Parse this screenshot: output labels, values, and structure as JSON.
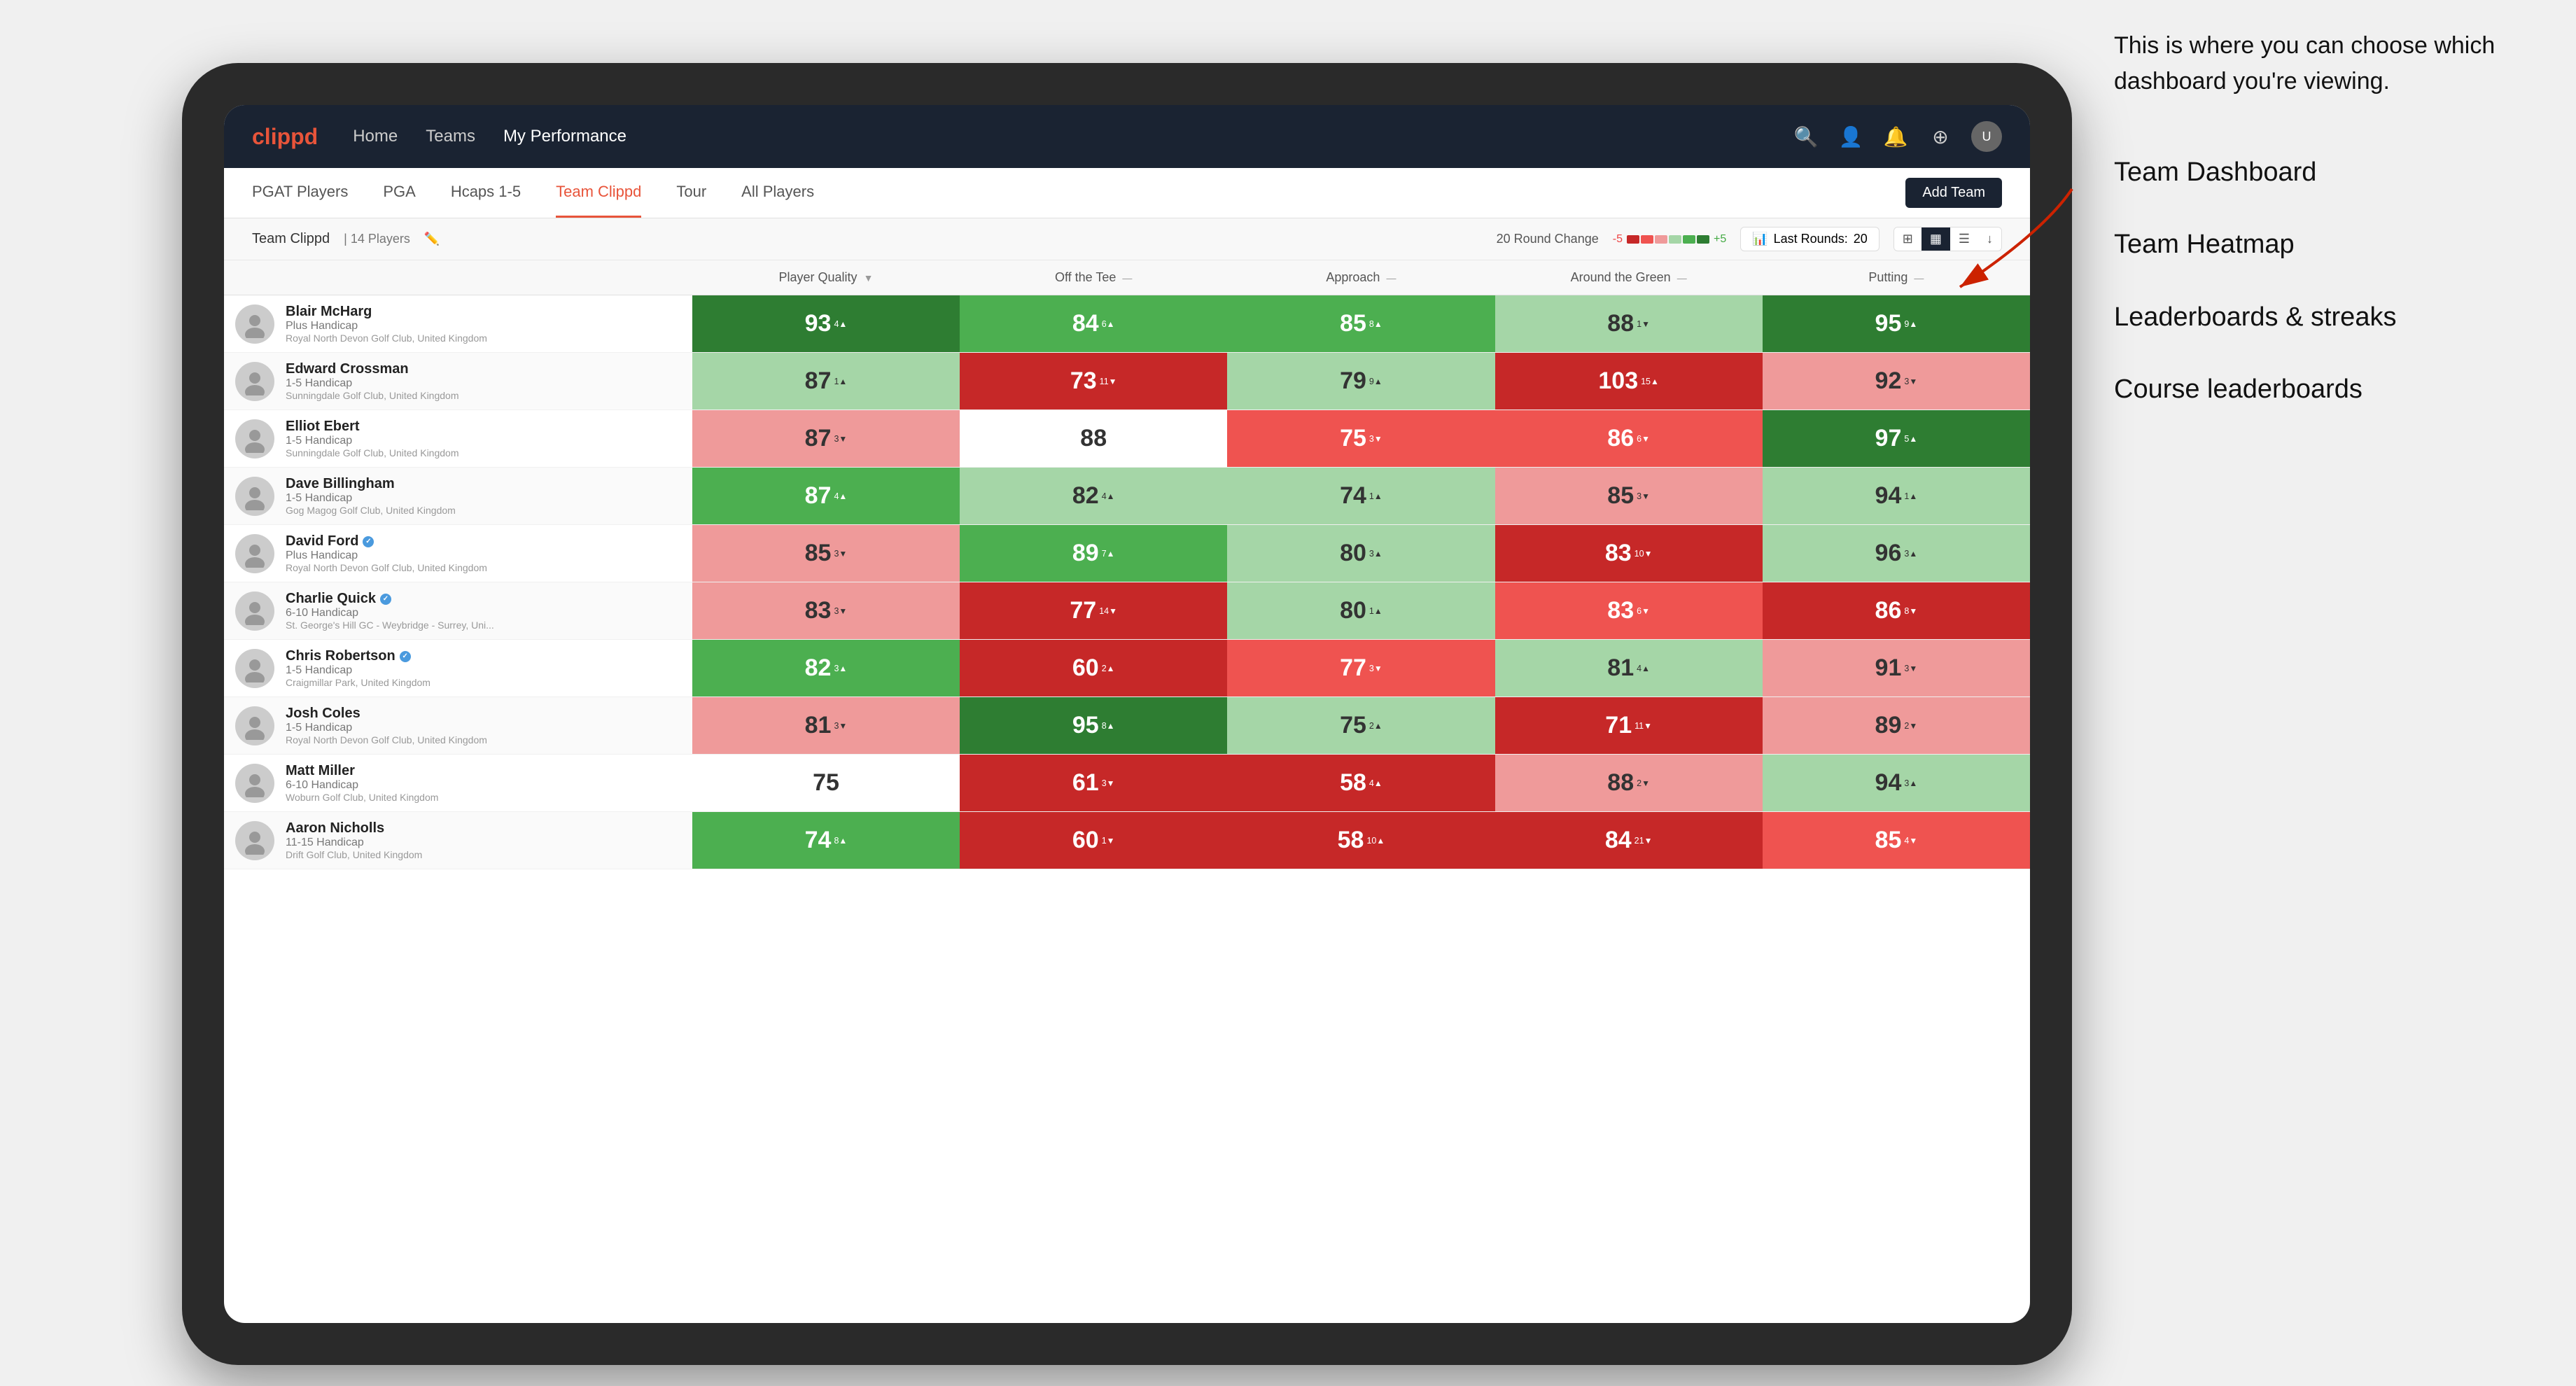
{
  "annotation": {
    "callout": "This is where you can choose which dashboard you're viewing.",
    "menu_items": [
      "Team Dashboard",
      "Team Heatmap",
      "Leaderboards & streaks",
      "Course leaderboards"
    ]
  },
  "nav": {
    "logo": "clippd",
    "links": [
      {
        "label": "Home",
        "active": false
      },
      {
        "label": "Teams",
        "active": false
      },
      {
        "label": "My Performance",
        "active": true
      }
    ],
    "icons": [
      "🔍",
      "👤",
      "🔔",
      "⊕"
    ]
  },
  "sub_nav": {
    "links": [
      {
        "label": "PGAT Players",
        "active": false
      },
      {
        "label": "PGA",
        "active": false
      },
      {
        "label": "Hcaps 1-5",
        "active": false
      },
      {
        "label": "Team Clippd",
        "active": true
      },
      {
        "label": "Tour",
        "active": false
      },
      {
        "label": "All Players",
        "active": false
      }
    ],
    "add_team_label": "Add Team"
  },
  "team_header": {
    "team_name": "Team Clippd",
    "separator": "|",
    "player_count": "14 Players",
    "round_change_label": "20 Round Change",
    "neg_value": "-5",
    "pos_value": "+5",
    "last_rounds_label": "Last Rounds:",
    "last_rounds_value": "20"
  },
  "table": {
    "columns": [
      {
        "label": "Player Quality",
        "sortable": true
      },
      {
        "label": "Off the Tee",
        "sortable": true
      },
      {
        "label": "Approach",
        "sortable": true
      },
      {
        "label": "Around the Green",
        "sortable": true
      },
      {
        "label": "Putting",
        "sortable": true
      }
    ],
    "rows": [
      {
        "name": "Blair McHarg",
        "handicap": "Plus Handicap",
        "club": "Royal North Devon Golf Club, United Kingdom",
        "verified": false,
        "scores": [
          {
            "val": "93",
            "change": "4",
            "dir": "up",
            "color": "green-dark"
          },
          {
            "val": "84",
            "change": "6",
            "dir": "up",
            "color": "green-med"
          },
          {
            "val": "85",
            "change": "8",
            "dir": "up",
            "color": "green-med"
          },
          {
            "val": "88",
            "change": "1",
            "dir": "down",
            "color": "green-light"
          },
          {
            "val": "95",
            "change": "9",
            "dir": "up",
            "color": "green-dark"
          }
        ]
      },
      {
        "name": "Edward Crossman",
        "handicap": "1-5 Handicap",
        "club": "Sunningdale Golf Club, United Kingdom",
        "verified": false,
        "scores": [
          {
            "val": "87",
            "change": "1",
            "dir": "up",
            "color": "green-light"
          },
          {
            "val": "73",
            "change": "11",
            "dir": "down",
            "color": "red-dark"
          },
          {
            "val": "79",
            "change": "9",
            "dir": "up",
            "color": "green-light"
          },
          {
            "val": "103",
            "change": "15",
            "dir": "up",
            "color": "red-dark"
          },
          {
            "val": "92",
            "change": "3",
            "dir": "down",
            "color": "red-light"
          }
        ]
      },
      {
        "name": "Elliot Ebert",
        "handicap": "1-5 Handicap",
        "club": "Sunningdale Golf Club, United Kingdom",
        "verified": false,
        "scores": [
          {
            "val": "87",
            "change": "3",
            "dir": "down",
            "color": "red-light"
          },
          {
            "val": "88",
            "change": "",
            "dir": "",
            "color": "white"
          },
          {
            "val": "75",
            "change": "3",
            "dir": "down",
            "color": "red-med"
          },
          {
            "val": "86",
            "change": "6",
            "dir": "down",
            "color": "red-med"
          },
          {
            "val": "97",
            "change": "5",
            "dir": "up",
            "color": "green-dark"
          }
        ]
      },
      {
        "name": "Dave Billingham",
        "handicap": "1-5 Handicap",
        "club": "Gog Magog Golf Club, United Kingdom",
        "verified": false,
        "scores": [
          {
            "val": "87",
            "change": "4",
            "dir": "up",
            "color": "green-med"
          },
          {
            "val": "82",
            "change": "4",
            "dir": "up",
            "color": "green-light"
          },
          {
            "val": "74",
            "change": "1",
            "dir": "up",
            "color": "green-light"
          },
          {
            "val": "85",
            "change": "3",
            "dir": "down",
            "color": "red-light"
          },
          {
            "val": "94",
            "change": "1",
            "dir": "up",
            "color": "green-light"
          }
        ]
      },
      {
        "name": "David Ford",
        "handicap": "Plus Handicap",
        "club": "Royal North Devon Golf Club, United Kingdom",
        "verified": true,
        "scores": [
          {
            "val": "85",
            "change": "3",
            "dir": "down",
            "color": "red-light"
          },
          {
            "val": "89",
            "change": "7",
            "dir": "up",
            "color": "green-med"
          },
          {
            "val": "80",
            "change": "3",
            "dir": "up",
            "color": "green-light"
          },
          {
            "val": "83",
            "change": "10",
            "dir": "down",
            "color": "red-dark"
          },
          {
            "val": "96",
            "change": "3",
            "dir": "up",
            "color": "green-light"
          }
        ]
      },
      {
        "name": "Charlie Quick",
        "handicap": "6-10 Handicap",
        "club": "St. George's Hill GC - Weybridge - Surrey, Uni...",
        "verified": true,
        "scores": [
          {
            "val": "83",
            "change": "3",
            "dir": "down",
            "color": "red-light"
          },
          {
            "val": "77",
            "change": "14",
            "dir": "down",
            "color": "red-dark"
          },
          {
            "val": "80",
            "change": "1",
            "dir": "up",
            "color": "green-light"
          },
          {
            "val": "83",
            "change": "6",
            "dir": "down",
            "color": "red-med"
          },
          {
            "val": "86",
            "change": "8",
            "dir": "down",
            "color": "red-dark"
          }
        ]
      },
      {
        "name": "Chris Robertson",
        "handicap": "1-5 Handicap",
        "club": "Craigmillar Park, United Kingdom",
        "verified": true,
        "scores": [
          {
            "val": "82",
            "change": "3",
            "dir": "up",
            "color": "green-med"
          },
          {
            "val": "60",
            "change": "2",
            "dir": "up",
            "color": "red-dark"
          },
          {
            "val": "77",
            "change": "3",
            "dir": "down",
            "color": "red-med"
          },
          {
            "val": "81",
            "change": "4",
            "dir": "up",
            "color": "green-light"
          },
          {
            "val": "91",
            "change": "3",
            "dir": "down",
            "color": "red-light"
          }
        ]
      },
      {
        "name": "Josh Coles",
        "handicap": "1-5 Handicap",
        "club": "Royal North Devon Golf Club, United Kingdom",
        "verified": false,
        "scores": [
          {
            "val": "81",
            "change": "3",
            "dir": "down",
            "color": "red-light"
          },
          {
            "val": "95",
            "change": "8",
            "dir": "up",
            "color": "green-dark"
          },
          {
            "val": "75",
            "change": "2",
            "dir": "up",
            "color": "green-light"
          },
          {
            "val": "71",
            "change": "11",
            "dir": "down",
            "color": "red-dark"
          },
          {
            "val": "89",
            "change": "2",
            "dir": "down",
            "color": "red-light"
          }
        ]
      },
      {
        "name": "Matt Miller",
        "handicap": "6-10 Handicap",
        "club": "Woburn Golf Club, United Kingdom",
        "verified": false,
        "scores": [
          {
            "val": "75",
            "change": "",
            "dir": "",
            "color": "white"
          },
          {
            "val": "61",
            "change": "3",
            "dir": "down",
            "color": "red-dark"
          },
          {
            "val": "58",
            "change": "4",
            "dir": "up",
            "color": "red-dark"
          },
          {
            "val": "88",
            "change": "2",
            "dir": "down",
            "color": "red-light"
          },
          {
            "val": "94",
            "change": "3",
            "dir": "up",
            "color": "green-light"
          }
        ]
      },
      {
        "name": "Aaron Nicholls",
        "handicap": "11-15 Handicap",
        "club": "Drift Golf Club, United Kingdom",
        "verified": false,
        "scores": [
          {
            "val": "74",
            "change": "8",
            "dir": "up",
            "color": "green-med"
          },
          {
            "val": "60",
            "change": "1",
            "dir": "down",
            "color": "red-dark"
          },
          {
            "val": "58",
            "change": "10",
            "dir": "up",
            "color": "red-dark"
          },
          {
            "val": "84",
            "change": "21",
            "dir": "down",
            "color": "red-dark"
          },
          {
            "val": "85",
            "change": "4",
            "dir": "down",
            "color": "red-med"
          }
        ]
      }
    ]
  }
}
